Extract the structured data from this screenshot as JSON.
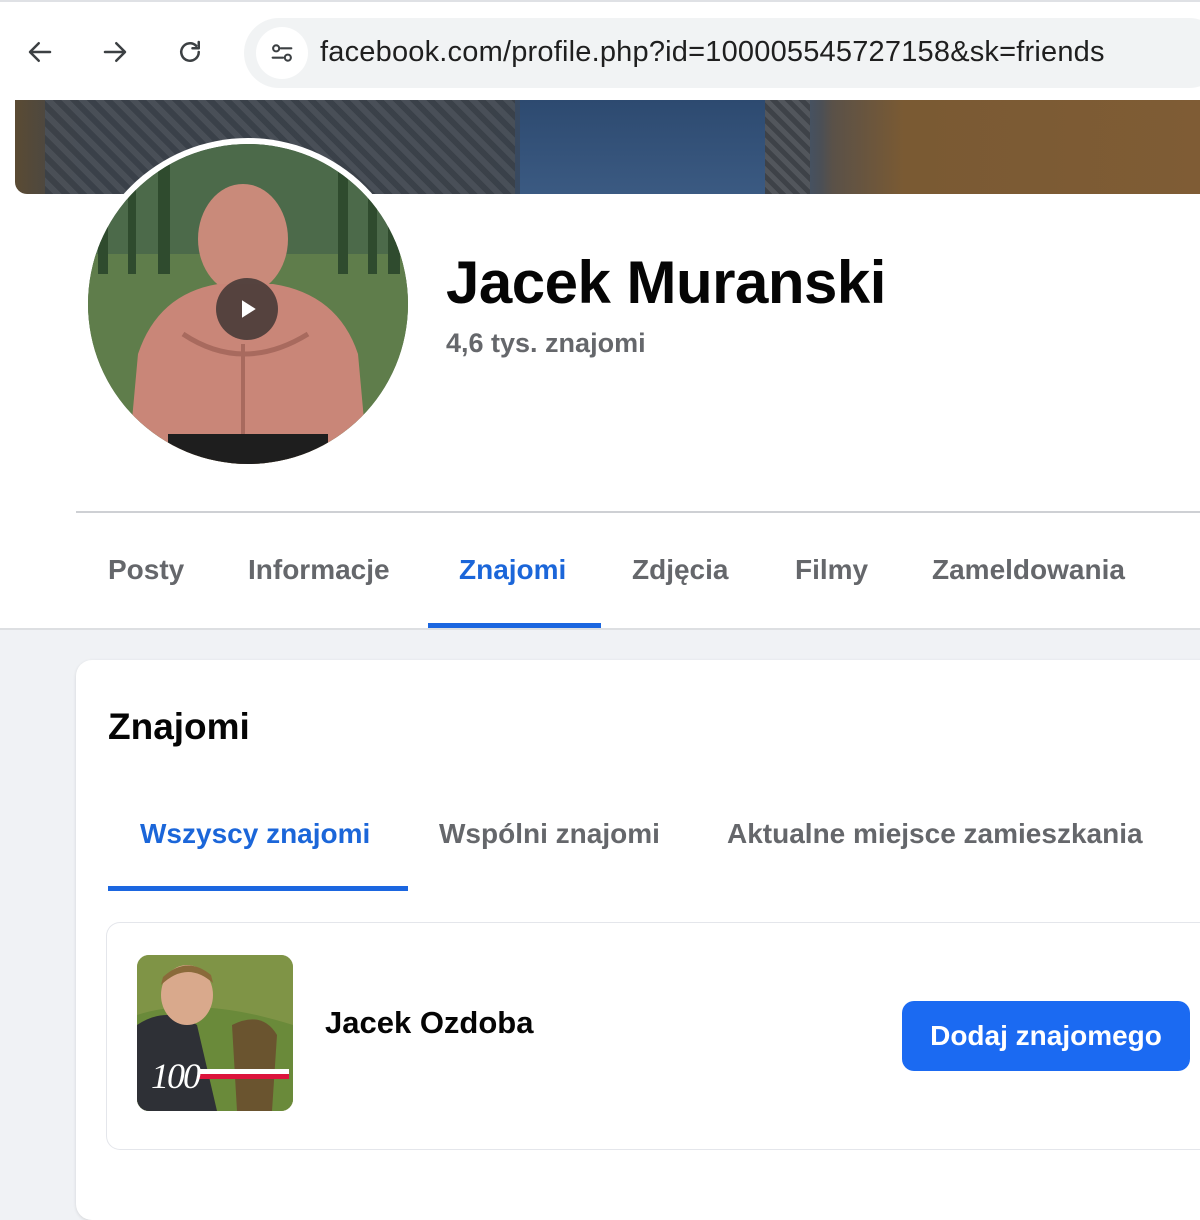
{
  "browser": {
    "url": "facebook.com/profile.php?id=100005545727158&sk=friends",
    "icons": [
      "back-arrow-icon",
      "forward-arrow-icon",
      "reload-icon",
      "site-settings-icon"
    ]
  },
  "profile": {
    "name": "Jacek Muranski",
    "friends_count": "4,6 tys. znajomi",
    "tabs": [
      {
        "label": "Posty"
      },
      {
        "label": "Informacje"
      },
      {
        "label": "Znajomi"
      },
      {
        "label": "Zdjęcia"
      },
      {
        "label": "Filmy"
      },
      {
        "label": "Zameldowania"
      }
    ],
    "active_tab": "Znajomi"
  },
  "friends_section": {
    "title": "Znajomi",
    "sub_tabs": [
      {
        "label": "Wszyscy znajomi"
      },
      {
        "label": "Wspólni znajomi"
      },
      {
        "label": "Aktualne miejsce zamieszkania"
      }
    ],
    "active_sub_tab": "Wszyscy znajomi",
    "friends": [
      {
        "name": "Jacek Ozdoba",
        "photo_text": "100",
        "action_label": "Dodaj znajomego"
      }
    ]
  },
  "colors": {
    "accent": "#1b66d9",
    "button": "#1b6af2",
    "muted_text": "#65676b",
    "page_bg": "#f0f2f5"
  }
}
